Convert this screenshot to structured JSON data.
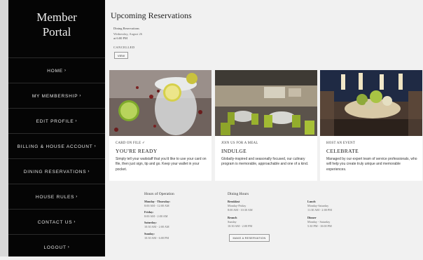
{
  "sidebar": {
    "brand_line1": "Member",
    "brand_line2": "Portal",
    "items": [
      {
        "label": "HOME",
        "chev": "›"
      },
      {
        "label": "MY MEMBERSHIP",
        "chev": "›"
      },
      {
        "label": "EDIT PROFILE",
        "chev": "›"
      },
      {
        "label": "BILLING & HOUSE ACCOUNT",
        "chev": "›"
      },
      {
        "label": "DINING RESERVATIONS",
        "chev": "›"
      },
      {
        "label": "HOUSE RULES",
        "chev": "›"
      },
      {
        "label": "CONTACT US",
        "chev": "›"
      },
      {
        "label": "LOGOUT",
        "chev": "›"
      }
    ]
  },
  "main": {
    "title": "Upcoming Reservations",
    "reservation": {
      "label": "Dining Reservations",
      "date": "Wednesday, August 26",
      "time": "at 6:00 PM",
      "status": "CANCELLED",
      "view_label": "VIEW"
    },
    "cards": [
      {
        "category": "CARD ON FILE ✓",
        "title": "YOU'RE READY",
        "body": "Simply tell your waitstaff that you'd like to use your card on file, then just sign, tip and go. Keep your wallet in your pocket."
      },
      {
        "category": "JOIN US FOR A MEAL",
        "title": "INDULGE",
        "body": "Globally-inspired and seasonally focused, our culinary program is memorable, approachable and one of a kind."
      },
      {
        "category": "HOST AN EVENT",
        "title": "CELEBRATE",
        "body": "Managed by our expert team of service professionals, who will help you create truly unique and memorable experiences."
      }
    ],
    "hours": {
      "title": "Hours of Operation",
      "entries": [
        {
          "label": "Monday - Thursday:",
          "value": "8:00 AM - 12:00 AM"
        },
        {
          "label": "Friday:",
          "value": "8:00 AM - 2:00 AM"
        },
        {
          "label": "Saturday:",
          "value": "10:30 AM - 2:00 AM"
        },
        {
          "label": "Sunday:",
          "value": "10:30 AM - 6:00 PM"
        }
      ]
    },
    "dining": {
      "title": "Dining Hours",
      "breakfast_label": "Breakfast",
      "breakfast_value1": "Monday-Friday",
      "breakfast_value2": "8:00 AM - 10:30 AM",
      "brunch_label": "Brunch",
      "brunch_value1": "Sunday",
      "brunch_value2": "10:30 AM - 2:00 PM",
      "lunch_label": "Lunch",
      "lunch_value1": "Monday-Saturday",
      "lunch_value2": "11:30 AM - 2:00 PM",
      "dinner_label": "Dinner",
      "dinner_value1": "Monday - Saturday",
      "dinner_value2": "5:30 PM - 10:00 PM",
      "make_res_label": "MAKE A RESERVATION"
    }
  }
}
